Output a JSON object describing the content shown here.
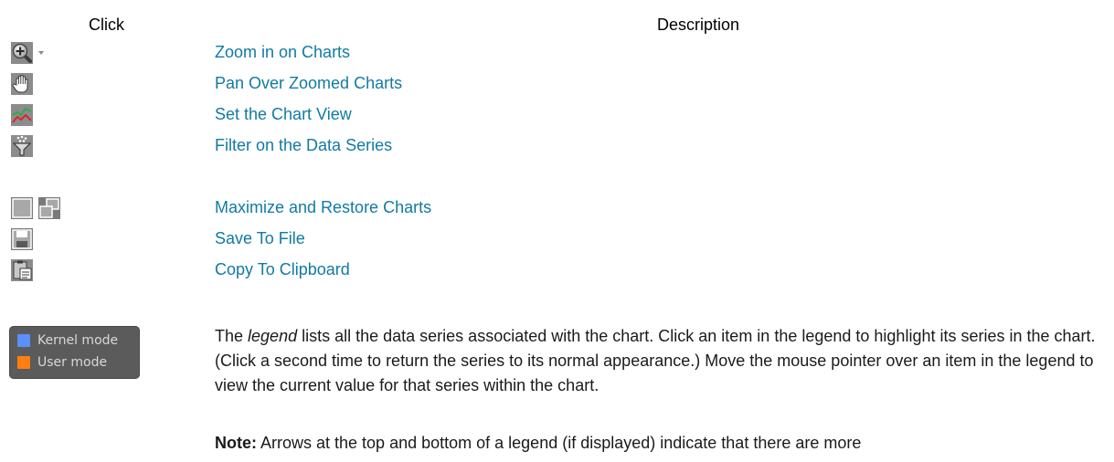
{
  "table": {
    "header_click": "Click",
    "header_description": "Description"
  },
  "rows": [
    {
      "label": "Zoom in on Charts",
      "icon": "zoom-in-icon"
    },
    {
      "label": "Pan Over Zoomed Charts",
      "icon": "hand-pan-icon"
    },
    {
      "label": "Set the Chart View",
      "icon": "chart-view-icon"
    },
    {
      "label": "Filter on the Data Series",
      "icon": "filter-icon"
    },
    {
      "label": "Maximize and Restore Charts",
      "icon": "maximize-restore-icon"
    },
    {
      "label": "Save To File",
      "icon": "save-icon"
    },
    {
      "label": "Copy To Clipboard",
      "icon": "clipboard-icon"
    }
  ],
  "legend": {
    "items": [
      {
        "label": "Kernel mode",
        "color": "#5b8ff9"
      },
      {
        "label": "User mode",
        "color": "#ff7f0e"
      }
    ],
    "para_before": "The ",
    "para_em": "legend",
    "para_after": " lists all the data series associated with the chart. Click an item in the legend to highlight its series in the chart. (Click a second time to return the series to its normal appearance.) Move the mouse pointer over an item in the legend to view the current value for that series within the chart.",
    "note_label": "Note:",
    "note_text": " Arrows at the top and bottom of a legend (if displayed) indicate that there are more"
  },
  "colors": {
    "link": "#117aa3",
    "legend_bg": "#5b5b5b",
    "legend_text": "#d8d8d8"
  }
}
